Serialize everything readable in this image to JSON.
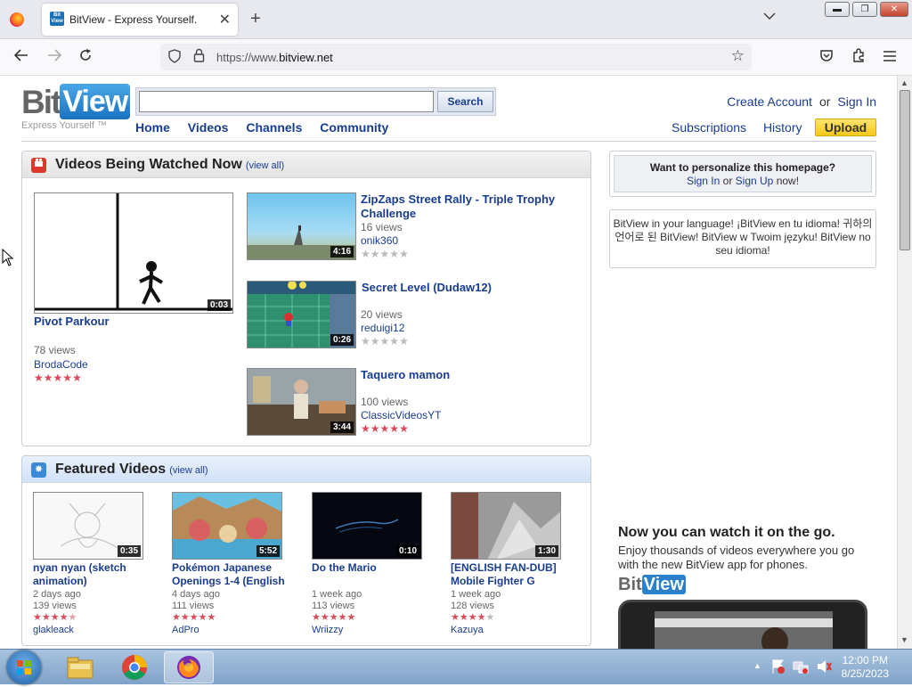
{
  "browser": {
    "tab_title": "BitView - Express Yourself.",
    "favicon_text": "Bit View",
    "url_prefix": "https://www.",
    "url_host": "bitview.net"
  },
  "site": {
    "logo_bit": "Bit",
    "logo_view": "View",
    "tagline": "Express Yourself ™",
    "search_button": "Search",
    "search_placeholder": "",
    "nav": [
      "Home",
      "Videos",
      "Channels",
      "Community"
    ],
    "create_account": "Create Account",
    "or": "or",
    "sign_in": "Sign In",
    "subnav": [
      "Subscriptions",
      "History"
    ],
    "upload": "Upload"
  },
  "watched": {
    "title": "Videos Being Watched Now",
    "view_all": "(view all)",
    "main": {
      "title": "Pivot Parkour",
      "duration": "0:03",
      "views": "78 views",
      "user": "BrodaCode",
      "rating": 5
    },
    "list": [
      {
        "title": "ZipZaps Street Rally - Triple Trophy Challenge",
        "duration": "4:16",
        "views": "16 views",
        "user": "onik360",
        "rating": 0
      },
      {
        "title": "Secret Level (Dudaw12)",
        "duration": "0:26",
        "views": "20 views",
        "user": "reduigi12",
        "rating": 0
      },
      {
        "title": "Taquero mamon",
        "duration": "3:44",
        "views": "100 views",
        "user": "ClassicVideosYT",
        "rating": 5
      }
    ]
  },
  "featured": {
    "title": "Featured Videos",
    "view_all": "(view all)",
    "items": [
      {
        "title": "nyan nyan (sketch animation)",
        "duration": "0:35",
        "age": "2 days ago",
        "views": "139 views",
        "user": "glakleack",
        "rating": 4.5
      },
      {
        "title": "Pokémon Japanese Openings 1-4 (English",
        "duration": "5:52",
        "age": "4 days ago",
        "views": "111 views",
        "user": "AdPro",
        "rating": 5
      },
      {
        "title": "Do the Mario",
        "duration": "0:10",
        "age": "1 week ago",
        "views": "113 views",
        "user": "Wriizzy",
        "rating": 5
      },
      {
        "title": "[ENGLISH FAN-DUB] Mobile Fighter G",
        "duration": "1:30",
        "age": "1 week ago",
        "views": "128 views",
        "user": "Kazuya",
        "rating": 4
      }
    ]
  },
  "sidebar": {
    "personalize_q": "Want to personalize this homepage?",
    "sign_in": "Sign In",
    "or": "or",
    "sign_up": "Sign Up",
    "now": "now!",
    "language": "BitView in your language! ¡BitView en tu idioma! 귀하의 언어로 된 BitView! BitView w Twoim języku! BitView no seu idioma!",
    "promo_title": "Now you can watch it on the go.",
    "promo_text": "Enjoy thousands of videos everywhere you go with the new BitView app for phones.",
    "promo_logo_bit": "Bit",
    "promo_logo_view": "View"
  },
  "taskbar": {
    "time": "12:00 PM",
    "date": "8/25/2023"
  }
}
